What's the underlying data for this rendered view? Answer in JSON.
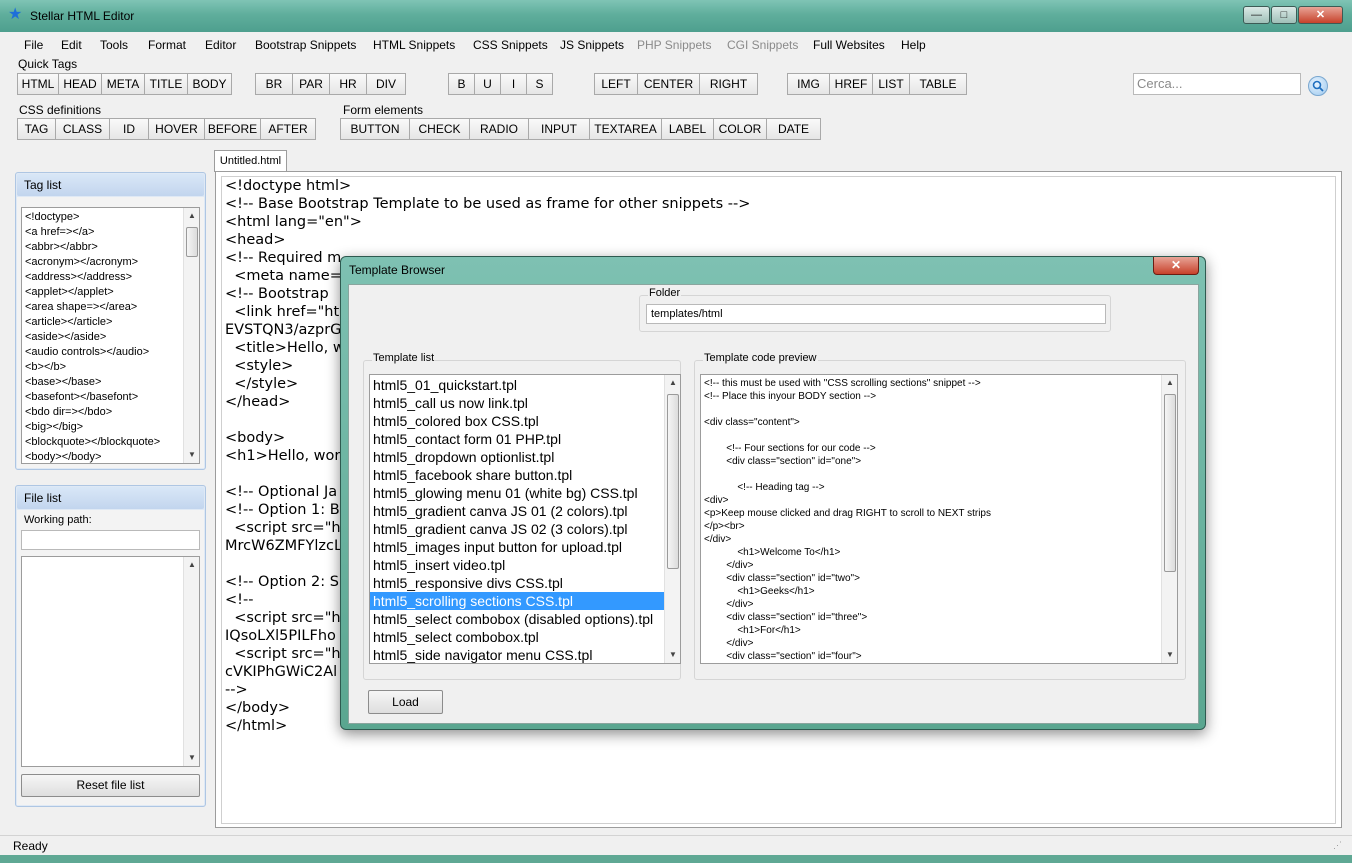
{
  "window": {
    "title": "Stellar HTML Editor",
    "controls": {
      "minimize": "—",
      "maximize": "□",
      "close": "✕"
    }
  },
  "menubar": {
    "items": [
      "File",
      "Edit",
      "Tools",
      "Format",
      "Editor",
      "Bootstrap Snippets",
      "HTML Snippets",
      "CSS Snippets",
      "JS Snippets",
      "PHP Snippets",
      "CGI Snippets",
      "Full Websites",
      "Help"
    ],
    "disabled": [
      "PHP Snippets",
      "CGI Snippets"
    ]
  },
  "quick_tags": {
    "label": "Quick Tags",
    "group1": [
      "HTML",
      "HEAD",
      "META",
      "TITLE",
      "BODY"
    ],
    "group2": [
      "BR",
      "PAR",
      "HR",
      "DIV"
    ],
    "group3": [
      "B",
      "U",
      "I",
      "S"
    ],
    "group4": [
      "LEFT",
      "CENTER",
      "RIGHT"
    ],
    "group5": [
      "IMG",
      "HREF",
      "LIST",
      "TABLE"
    ]
  },
  "search": {
    "placeholder": "Cerca...",
    "icon": "search-icon"
  },
  "css_definitions": {
    "label": "CSS definitions",
    "buttons": [
      "TAG",
      "CLASS",
      "ID",
      "HOVER",
      "BEFORE",
      "AFTER"
    ]
  },
  "form_elements": {
    "label": "Form elements",
    "buttons": [
      "BUTTON",
      "CHECK",
      "RADIO",
      "INPUT",
      "TEXTAREA",
      "LABEL",
      "COLOR",
      "DATE"
    ]
  },
  "tag_list": {
    "title": "Tag list",
    "items": [
      "<!doctype>",
      "<a href=></a>",
      "<abbr></abbr>",
      "<acronym></acronym>",
      "<address></address>",
      "<applet></applet>",
      "<area shape=></area>",
      "<article></article>",
      "<aside></aside>",
      "<audio controls></audio>",
      "<b></b>",
      "<base></base>",
      "<basefont></basefont>",
      "<bdo dir=></bdo>",
      "<big></big>",
      "<blockquote></blockquote>",
      "<body></body>"
    ]
  },
  "file_list": {
    "title": "File list",
    "working_path_label": "Working path:",
    "working_path_value": "",
    "reset_button": "Reset file list"
  },
  "editor": {
    "tab": "Untitled.html",
    "lines": [
      "<!doctype html>",
      "<!-- Base Bootstrap Template to be used as frame for other snippets -->",
      "<html lang=\"en\">",
      "<head>",
      "<!-- Required m",
      "  <meta name=",
      "<!-- Bootstrap",
      "  <link href=\"ht",
      "EVSTQN3/azprG",
      "  <title>Hello, w",
      "  <style>",
      "  </style>",
      "</head>",
      "",
      "<body>",
      "<h1>Hello, wor",
      "",
      "<!-- Optional Ja",
      "<!-- Option 1: B",
      "  <script src=\"h",
      "MrcW6ZMFYlzcL",
      "",
      "<!-- Option 2: S",
      "<!--",
      "  <script src=\"h",
      "IQsoLXl5PILFho",
      "  <script src=\"h",
      "cVKIPhGWiC2Al",
      "-->",
      "</body>",
      "</html>"
    ],
    "line_types": [
      "tag",
      "com",
      "tag",
      "tag",
      "com",
      "tag",
      "com",
      "tag",
      "plain",
      "tag",
      "tag",
      "tag",
      "tag",
      "plain",
      "tag",
      "h1",
      "plain",
      "com",
      "com",
      "tag",
      "plain",
      "plain",
      "com",
      "com",
      "tag",
      "plain",
      "tag",
      "plain",
      "com",
      "tag",
      "tag"
    ]
  },
  "status": {
    "text": "Ready"
  },
  "dialog": {
    "title": "Template Browser",
    "close": "✕",
    "folder": {
      "label": "Folder",
      "value": "templates/html"
    },
    "template_list": {
      "label": "Template list",
      "items": [
        "html5_01_quickstart.tpl",
        "html5_call us now link.tpl",
        "html5_colored box CSS.tpl",
        "html5_contact form 01 PHP.tpl",
        "html5_dropdown optionlist.tpl",
        "html5_facebook share button.tpl",
        "html5_glowing menu 01 (white bg) CSS.tpl",
        "html5_gradient canva JS 01 (2 colors).tpl",
        "html5_gradient canva JS 02 (3 colors).tpl",
        "html5_images input button for upload.tpl",
        "html5_insert video.tpl",
        "html5_responsive divs CSS.tpl",
        "html5_scrolling sections CSS.tpl",
        "html5_select combobox (disabled options).tpl",
        "html5_select combobox.tpl",
        "html5_side navigator menu CSS.tpl"
      ],
      "selected": "html5_scrolling sections CSS.tpl"
    },
    "preview": {
      "label": "Template code preview",
      "lines": [
        "<!-- this must be used with \"CSS scrolling sections\" snippet -->",
        "<!-- Place this inyour BODY section -->",
        "",
        "<div class=\"content\">",
        "",
        "        <!-- Four sections for our code -->",
        "        <div class=\"section\" id=\"one\">",
        "",
        "            <!-- Heading tag -->",
        "<div>",
        "<p>Keep mouse clicked and drag RIGHT to scroll to NEXT strips",
        "</p><br>",
        "</div>",
        "            <h1>Welcome To</h1>",
        "        </div>",
        "        <div class=\"section\" id=\"two\">",
        "            <h1>Geeks</h1>",
        "        </div>",
        "        <div class=\"section\" id=\"three\">",
        "            <h1>For</h1>",
        "        </div>",
        "        <div class=\"section\" id=\"four\">"
      ]
    },
    "load_button": "Load"
  }
}
